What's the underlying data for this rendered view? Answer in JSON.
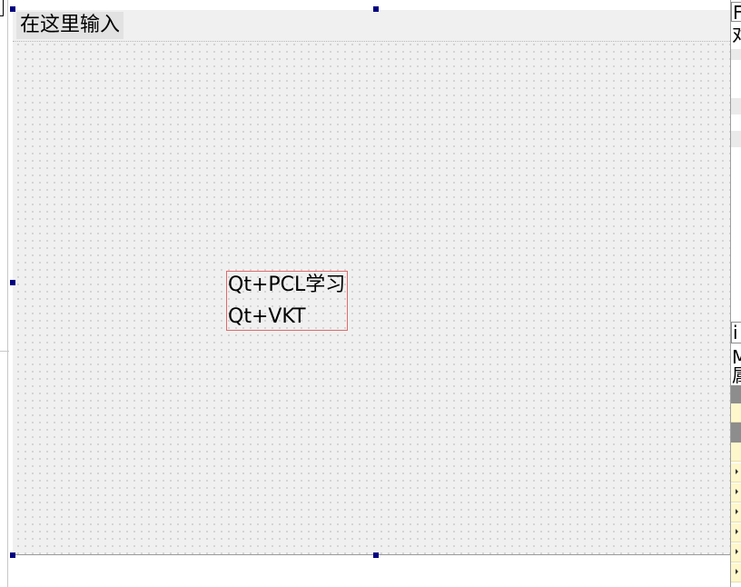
{
  "menubar": {
    "input_placeholder": "在这里输入"
  },
  "list_widget": {
    "items": [
      "Qt+PCL学习",
      "Qt+VKT"
    ]
  },
  "right_panel": {
    "top_text_1": "F",
    "top_text_2": "对",
    "mid_text_1": "i",
    "mid_text_2": "M",
    "mid_text_3": "属"
  }
}
